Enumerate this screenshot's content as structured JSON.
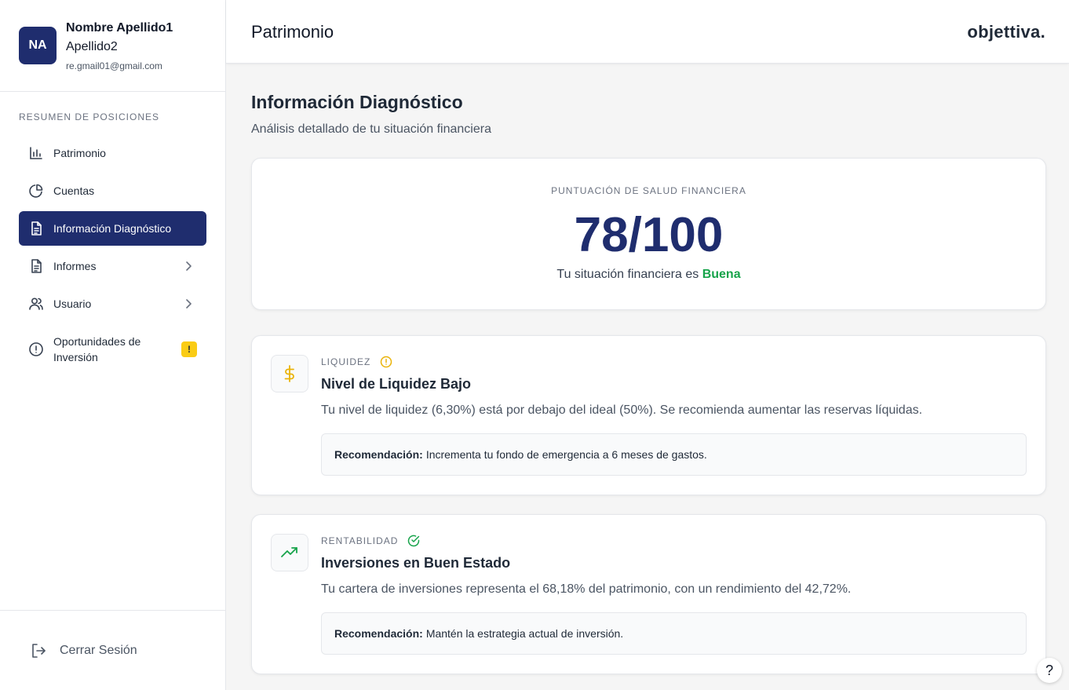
{
  "user": {
    "initials": "NA",
    "name_line1": "Nombre Apellido1",
    "name_line2": "Apellido2",
    "email": "re.gmail01@gmail.com"
  },
  "sidebar": {
    "section_title": "RESUMEN DE POSICIONES",
    "items": [
      {
        "label": "Patrimonio",
        "icon": "bar-chart-icon",
        "active": false
      },
      {
        "label": "Cuentas",
        "icon": "pie-chart-icon",
        "active": false
      },
      {
        "label": "Información Diagnóstico",
        "icon": "document-icon",
        "active": true
      },
      {
        "label": "Informes",
        "icon": "document-icon",
        "active": false,
        "chevron": true
      },
      {
        "label": "Usuario",
        "icon": "users-icon",
        "active": false,
        "chevron": true
      },
      {
        "label": "Oportunidades de Inversión",
        "icon": "alert-circle-icon",
        "active": false,
        "badge": "!"
      }
    ],
    "logout_label": "Cerrar Sesión"
  },
  "header": {
    "title": "Patrimonio",
    "brand": "objettiva."
  },
  "main": {
    "title": "Información Diagnóstico",
    "subtitle": "Análisis detallado de tu situación financiera",
    "score": {
      "label": "PUNTUACIÓN DE SALUD FINANCIERA",
      "value": "78/100",
      "text_prefix": "Tu situación financiera es",
      "status": "Buena",
      "status_color": "#16a34a"
    },
    "insights": [
      {
        "category": "LIQUIDEZ",
        "icon": "dollar-icon",
        "status_icon": "warning-circle-icon",
        "title": "Nivel de Liquidez Bajo",
        "description": "Tu nivel de liquidez (6,30%) está por debajo del ideal (50%). Se recomienda aumentar las reservas líquidas.",
        "rec_label": "Recomendación:",
        "rec_text": "Incrementa tu fondo de emergencia a 6 meses de gastos."
      },
      {
        "category": "RENTABILIDAD",
        "icon": "trending-up-icon",
        "status_icon": "check-circle-icon",
        "title": "Inversiones en Buen Estado",
        "description": "Tu cartera de inversiones representa el 68,18% del patrimonio, con un rendimiento del 42,72%.",
        "rec_label": "Recomendación:",
        "rec_text": "Mantén la estrategia actual de inversión."
      }
    ]
  },
  "help_label": "?",
  "colors": {
    "primary": "#1f2d6e",
    "warning": "#eab308",
    "success": "#16a34a"
  }
}
